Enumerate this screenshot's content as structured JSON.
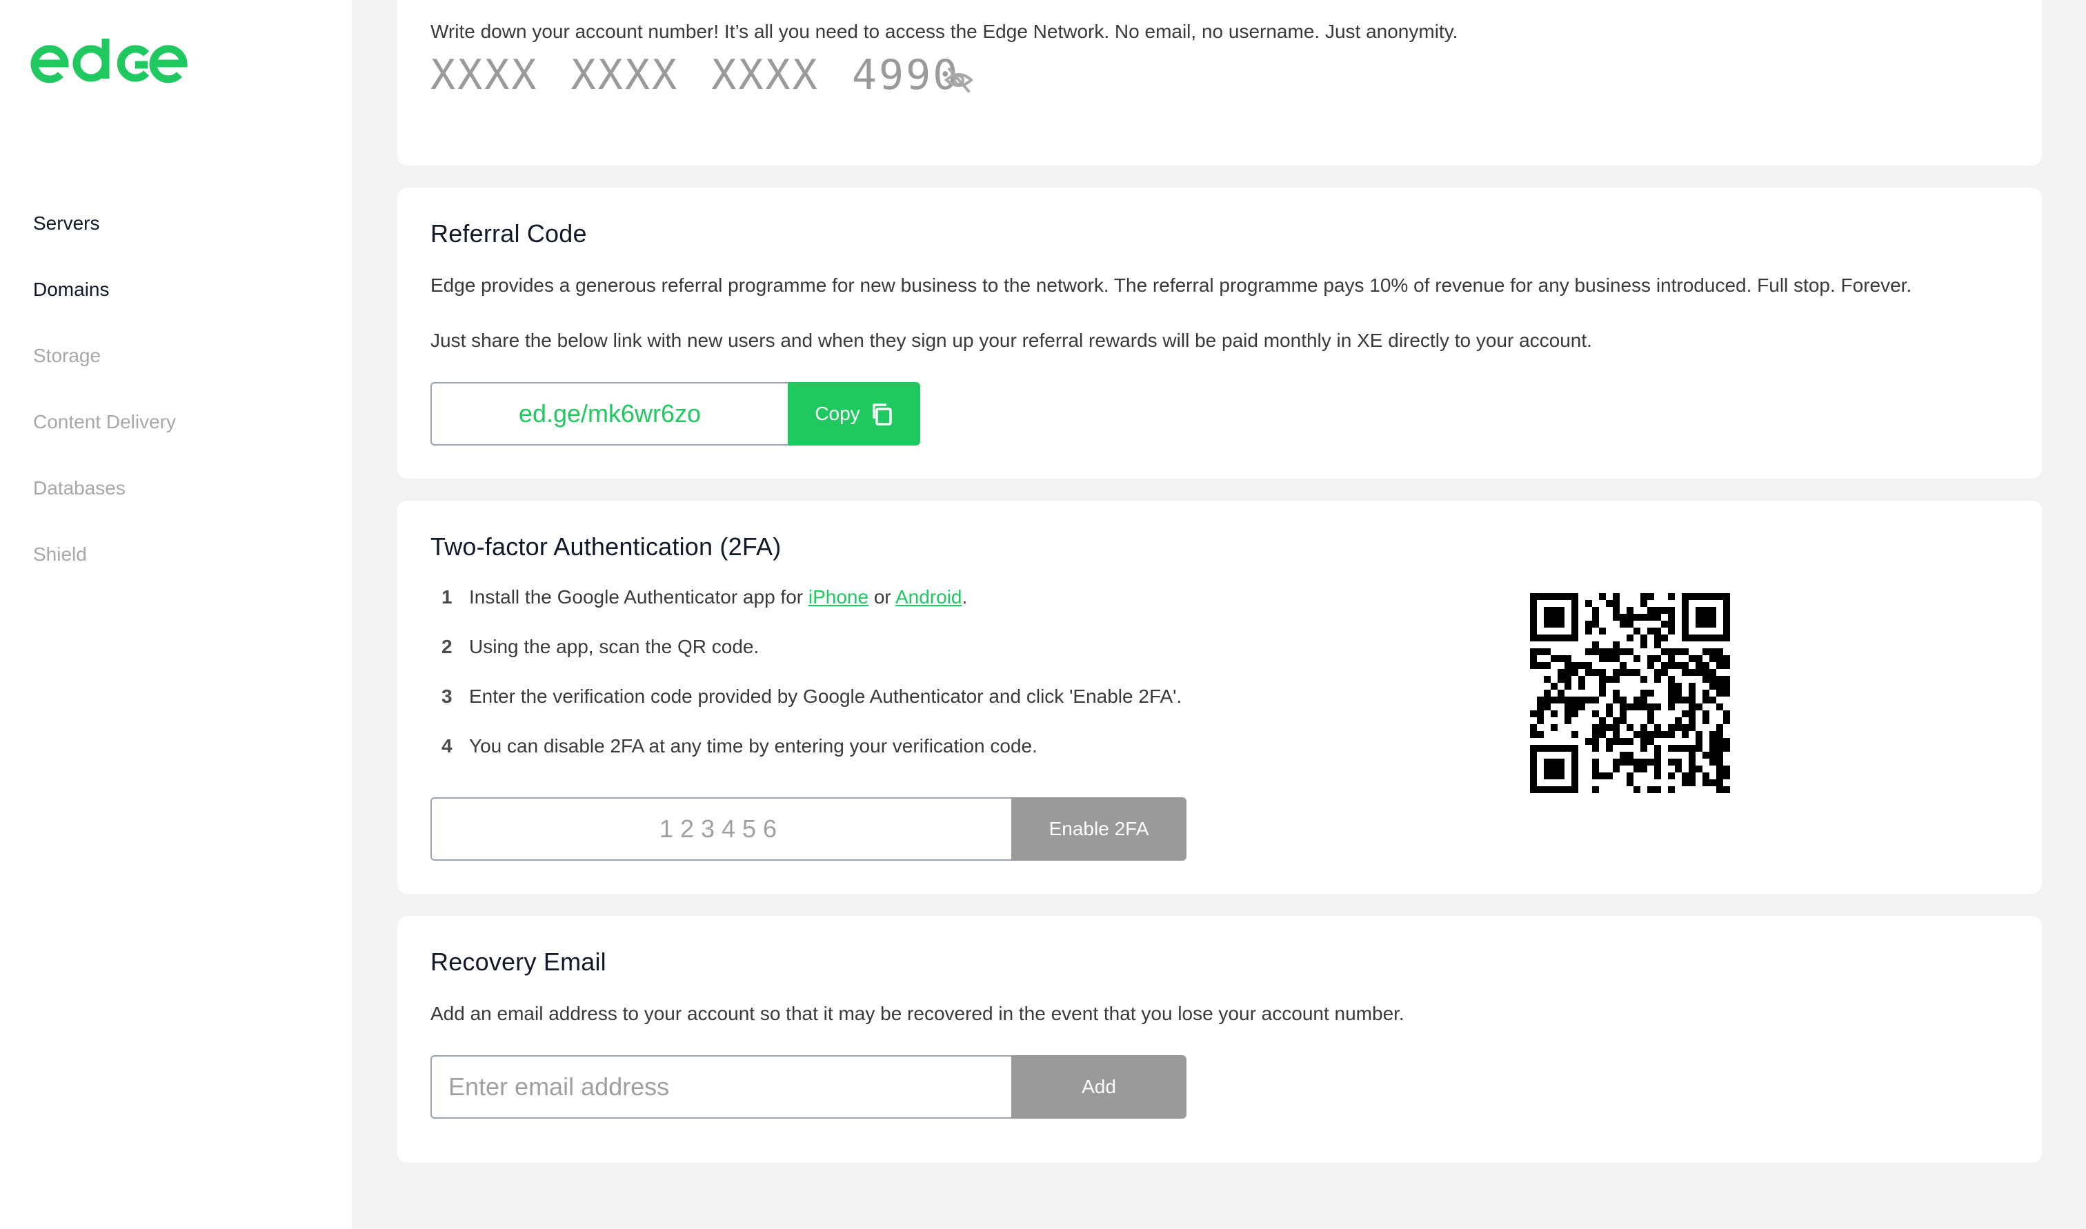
{
  "brand": {
    "logo_text": "edge",
    "accent_color": "#1fc95f"
  },
  "sidebar": {
    "items": [
      {
        "label": "Servers",
        "state": "active"
      },
      {
        "label": "Domains",
        "state": "active"
      },
      {
        "label": "Storage",
        "state": "disabled"
      },
      {
        "label": "Content Delivery",
        "state": "disabled"
      },
      {
        "label": "Databases",
        "state": "disabled"
      },
      {
        "label": "Shield",
        "state": "disabled"
      }
    ]
  },
  "account": {
    "note": "Write down your account number! It’s all you need to access the Edge Network. No email, no username. Just anonymity.",
    "number": "XXXX XXXX XXXX 4990",
    "toggle_icon": "eye-off-icon"
  },
  "referral": {
    "title": "Referral Code",
    "description": "Edge provides a generous referral programme for new business to the network. The referral programme pays 10% of revenue for any business introduced. Full stop. Forever.",
    "share_text": "Just share the below link with new users and when they sign up your referral rewards will be paid monthly in XE directly to your account.",
    "link": "ed.ge/mk6wr6zo",
    "copy_label": "Copy",
    "copy_icon": "copy-icon"
  },
  "twofa": {
    "title": "Two-factor Authentication (2FA)",
    "steps": [
      {
        "num": "1",
        "pre": "Install the Google Authenticator app for ",
        "link1": "iPhone",
        "mid": " or ",
        "link2": "Android",
        "post": "."
      },
      {
        "num": "2",
        "text": "Using the app, scan the QR code."
      },
      {
        "num": "3",
        "text": "Enter the verification code provided by Google Authenticator and click 'Enable 2FA'."
      },
      {
        "num": "4",
        "text": "You can disable 2FA at any time by entering your verification code."
      }
    ],
    "code_placeholder": "123456",
    "code_value": "",
    "enable_label": "Enable 2FA",
    "qr_icon": "qr-code-icon"
  },
  "recovery": {
    "title": "Recovery Email",
    "description": "Add an email address to your account so that it may be recovered in the event that you lose your account number.",
    "email_placeholder": "Enter email address",
    "email_value": "",
    "add_label": "Add"
  }
}
